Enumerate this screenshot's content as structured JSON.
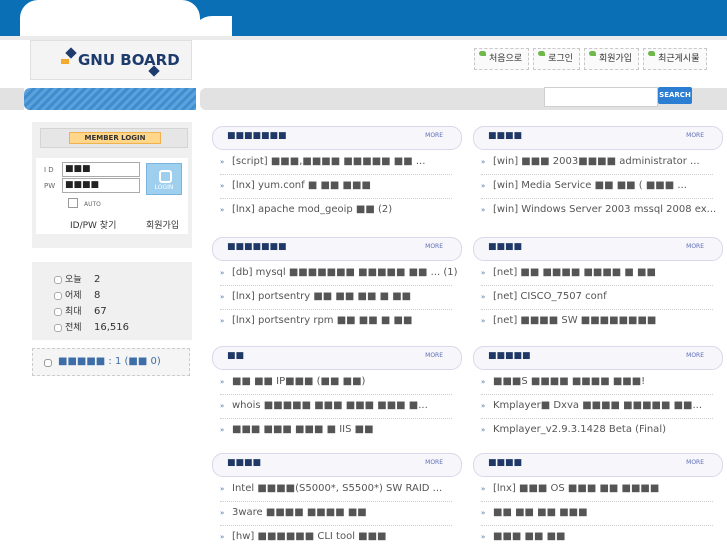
{
  "logo": {
    "text": "GNU BOARD"
  },
  "topnav": [
    "처음으로",
    "로그인",
    "회원가입",
    "최근게시물"
  ],
  "search": {
    "button": "SEARCH",
    "value": ""
  },
  "login": {
    "title": "MEMBER LOGIN",
    "id_label": "I D",
    "pw_label": "PW",
    "id_value": "■■■",
    "pw_value": "■■■■",
    "login_button": "LOGIN",
    "auto_label": "AUTO",
    "find_link": "ID/PW 찾기",
    "join_link": "회원가입"
  },
  "stats": [
    {
      "label": "오늘",
      "value": "2"
    },
    {
      "label": "어제",
      "value": "8"
    },
    {
      "label": "최대",
      "value": "67"
    },
    {
      "label": "전체",
      "value": "16,516"
    }
  ],
  "poll": {
    "text": "■■■■■ : 1 (■■ 0)"
  },
  "boards": [
    {
      "title": "■■■■■■■",
      "more": "MORE",
      "items": [
        "[script] ■■■,■■■■ ■■■■■ ■■ ...",
        "[lnx] yum.conf ■ ■■ ■■■",
        "[lnx] apache mod_geoip ■■ (2)"
      ]
    },
    {
      "title": "■■■■",
      "more": "MORE",
      "items": [
        "[win] ■■■ 2003■■■■ administrator ...",
        "[win] Media Service ■■ ■■ ( ■■■ ...",
        "[win] Windows Server 2003 mssql 2008 ex..."
      ]
    },
    {
      "title": "■■■■■■■",
      "more": "MORE",
      "items": [
        "[db] mysql ■■■■■■■ ■■■■■ ■■ ... (1)",
        "[lnx] portsentry ■■ ■■ ■■ ■ ■■",
        "[lnx] portsentry rpm ■■ ■■ ■ ■■"
      ]
    },
    {
      "title": "■■■■",
      "more": "MORE",
      "items": [
        "[net] ■■ ■■■■ ■■■■ ■ ■■",
        "[net] CISCO_7507 conf",
        "[net] ■■■■ SW ■■■■■■■■"
      ]
    },
    {
      "title": "■■",
      "more": "MORE",
      "items": [
        "■■ ■■ IP■■■ (■■ ■■)",
        "whois ■■■■■ ■■■ ■■■ ■■■ ■...",
        "■■■ ■■■ ■■■ ■ IIS ■■"
      ]
    },
    {
      "title": "■■■■■",
      "more": "MORE",
      "items": [
        "■■■S ■■■■ ■■■■ ■■■!",
        "Kmplayer■ Dxva ■■■■ ■■■■■ ■■...",
        "Kmplayer_v2.9.3.1428 Beta (Final)"
      ]
    },
    {
      "title": "■■■■",
      "more": "MORE",
      "items": [
        "Intel ■■■■(S5000*, S5500*) SW RAID ...",
        "3ware ■■■■ ■■■■ ■■",
        "[hw] ■■■■■■ CLI tool ■■■"
      ]
    },
    {
      "title": "■■■■",
      "more": "MORE",
      "items": [
        "[lnx] ■■■ OS ■■■ ■■ ■■■■",
        "■■ ■■ ■■ ■■■",
        "■■■ ■■ ■■"
      ]
    }
  ]
}
